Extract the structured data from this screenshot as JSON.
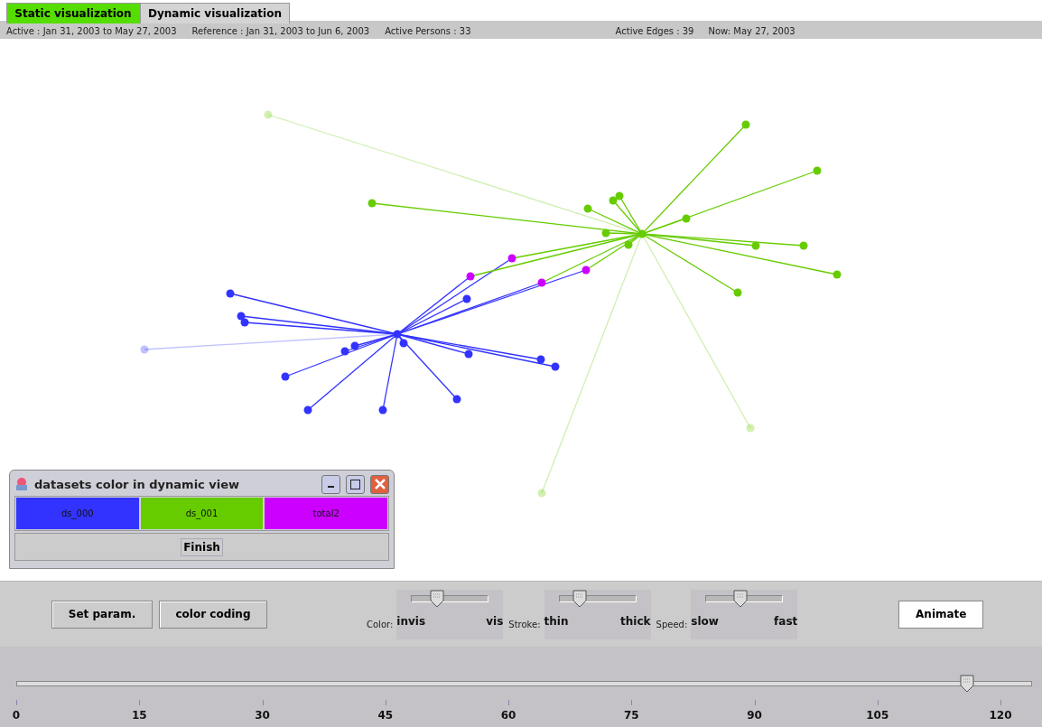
{
  "tabs": [
    {
      "label": "Static visualization",
      "selected": true
    },
    {
      "label": "Dynamic visualization",
      "selected": false
    }
  ],
  "info_bar": [
    "Active : Jan 31, 2003  to  May 27, 2003",
    "Reference : Jan 31, 2003 to Jun 6, 2003",
    "Active Persons : 33",
    "Active Edges : 39",
    "Now: May 27, 2003"
  ],
  "dialog": {
    "title": "datasets color in dynamic view",
    "datasets": [
      {
        "label": "ds_000",
        "color": "#3333ff"
      },
      {
        "label": "ds_001",
        "color": "#66cc00"
      },
      {
        "label": "total2",
        "color": "#cc00ff"
      }
    ],
    "finish": "Finish"
  },
  "controls": {
    "buttons": [
      "Set param.",
      "color coding"
    ],
    "sliders": [
      {
        "label": "Color:",
        "min": "invis",
        "max": "vis",
        "level": 0.33
      },
      {
        "label": "Stroke:",
        "min": "thin",
        "max": "thick",
        "level": 0.27
      },
      {
        "label": "Speed:",
        "min": "slow",
        "max": "fast",
        "level": 0.45
      }
    ],
    "animate": "Animate"
  },
  "timeline": {
    "level": 0.936,
    "ticks": [
      "0",
      "15",
      "30",
      "45",
      "60",
      "75",
      "90",
      "105",
      "120"
    ]
  }
}
